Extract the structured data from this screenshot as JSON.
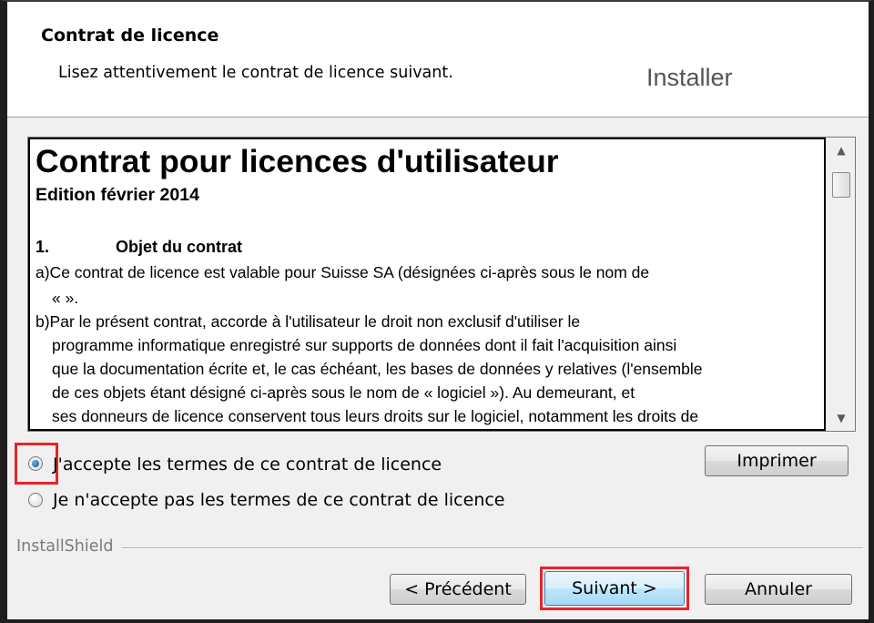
{
  "header": {
    "title": "Contrat de licence",
    "subtitle": "Lisez attentivement le contrat de licence suivant.",
    "brand": "Installer"
  },
  "license": {
    "title": "Contrat pour licences d'utilisateur",
    "edition": "Edition février 2014",
    "section_number": "1.",
    "section_title": "Objet du contrat",
    "lines": [
      "a)Ce contrat de licence est valable pour Suisse SA (désignées ci-après sous le nom de",
      "« ».",
      "b)Par le présent contrat, accorde à l'utilisateur le droit non exclusif d'utiliser le",
      "programme informatique enregistré sur supports de données dont il fait l'acquisition ainsi",
      "que la documentation écrite et, le cas échéant, les bases de données y relatives (l'ensemble",
      "de ces objets étant désigné ci-après sous le nom de « logiciel »). Au demeurant, et",
      "ses donneurs de licence conservent tous leurs droits sur le logiciel, notamment les droits de"
    ]
  },
  "scrollbar": {
    "up_icon": "▲",
    "down_icon": "▼"
  },
  "options": {
    "accept": {
      "label": "J'accepte les termes de ce contrat de licence",
      "checked": true
    },
    "decline": {
      "label": "Je n'accepte pas les termes de ce contrat de licence",
      "checked": false
    }
  },
  "buttons": {
    "print": "Imprimer",
    "back": "< Précédent",
    "next": "Suivant >",
    "cancel": "Annuler"
  },
  "footer": {
    "brand": "InstallShield"
  },
  "colors": {
    "highlight": "#e8232a",
    "dialog_bg": "#f0f0f0"
  }
}
